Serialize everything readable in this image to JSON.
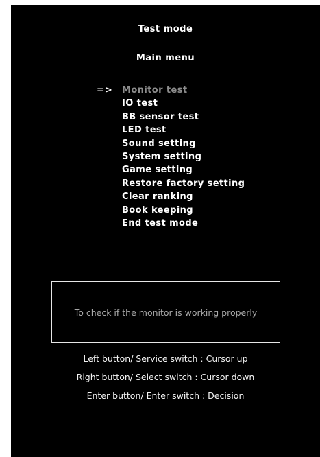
{
  "header": {
    "title": "Test mode",
    "subtitle": "Main menu"
  },
  "menu": {
    "cursor": "=>",
    "selected_index": 0,
    "items": [
      "Monitor test",
      "IO test",
      "BB sensor test",
      "LED test",
      "Sound setting",
      "System setting",
      "Game setting",
      "Restore factory setting",
      "Clear ranking",
      "Book keeping",
      "End test mode"
    ]
  },
  "description": "To check if the monitor is working properly",
  "help": {
    "line1": "Left button/ Service switch : Cursor up",
    "line2": "Right button/ Select switch : Cursor down",
    "line3": "Enter button/ Enter switch : Decision"
  },
  "colors": {
    "background": "#000000",
    "text": "#ffffff",
    "selected_item": "#8c8c8c",
    "description_text": "#a8a8a8"
  }
}
